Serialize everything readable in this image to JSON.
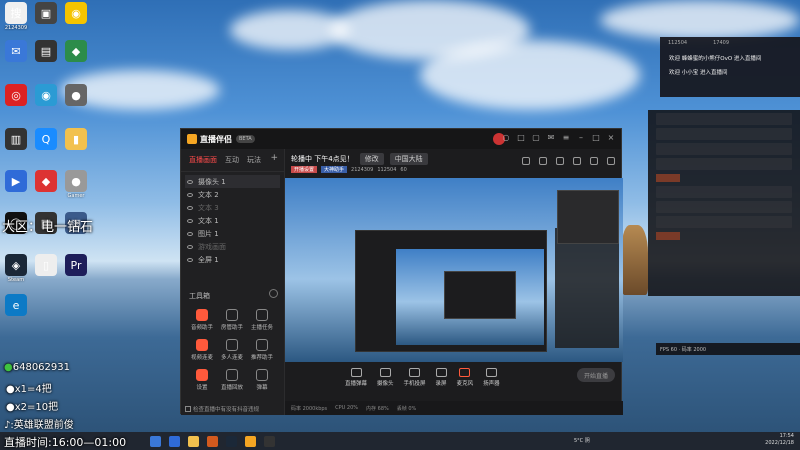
{
  "desktop": {
    "icons": [
      {
        "label": "2124309",
        "color": "#f0f0f0",
        "glyph": "搜"
      },
      {
        "label": "",
        "color": "#444",
        "glyph": "▣"
      },
      {
        "label": "",
        "color": "#f5c400",
        "glyph": "◉"
      },
      {
        "label": "",
        "color": "#3a78d8",
        "glyph": "✉"
      },
      {
        "label": "",
        "color": "#333",
        "glyph": "▤"
      },
      {
        "label": "",
        "color": "#2c8c4a",
        "glyph": "◆"
      },
      {
        "label": "",
        "color": "#d22",
        "glyph": "◎"
      },
      {
        "label": "",
        "color": "#2b9bd4",
        "glyph": "◉"
      },
      {
        "label": "",
        "color": "#666",
        "glyph": "●"
      },
      {
        "label": "",
        "color": "#333",
        "glyph": "▥"
      },
      {
        "label": "",
        "color": "#1a8cff",
        "glyph": "Q"
      },
      {
        "label": "",
        "color": "#f2c14e",
        "glyph": "▮"
      },
      {
        "label": "",
        "color": "#2f6bd8",
        "glyph": "▶"
      },
      {
        "label": "",
        "color": "#d33",
        "glyph": "◆"
      },
      {
        "label": "Gamer",
        "color": "#999",
        "glyph": "●"
      },
      {
        "label": "",
        "color": "#111",
        "glyph": "◯"
      },
      {
        "label": "",
        "color": "#333",
        "glyph": "▦"
      },
      {
        "label": "",
        "color": "#3a5a8a",
        "glyph": "▧"
      },
      {
        "label": "Steam",
        "color": "#1b2838",
        "glyph": "◈"
      },
      {
        "label": "",
        "color": "#eee",
        "glyph": "▯"
      },
      {
        "label": "",
        "color": "#1e1e5a",
        "glyph": "Pr"
      },
      {
        "label": "",
        "color": "#0c7ac6",
        "glyph": "e"
      }
    ]
  },
  "overlay": {
    "region": "大区：电一钻石",
    "wechat": "648062931",
    "x1": "x1=4把",
    "x2": "x2=10把",
    "douyin": "英雄联盟前俊",
    "time": "直播时间:16:00—01:00"
  },
  "app": {
    "name": "直播伴侣",
    "version": "BETA",
    "tabs": [
      "直播画面",
      "互动",
      "玩法"
    ],
    "active_tab": 0,
    "layers": [
      {
        "name": "摄像头 1",
        "selected": true,
        "dim": false
      },
      {
        "name": "文本 2",
        "selected": false,
        "dim": false
      },
      {
        "name": "文本 3",
        "selected": false,
        "dim": true
      },
      {
        "name": "文本 1",
        "selected": false,
        "dim": false
      },
      {
        "name": "图片 1",
        "selected": false,
        "dim": false
      },
      {
        "name": "游戏画面",
        "selected": false,
        "dim": true
      },
      {
        "name": "全屏 1",
        "selected": false,
        "dim": false
      }
    ],
    "tools_heading": "工具箱",
    "tools": [
      {
        "label": "音频助手",
        "hot": true
      },
      {
        "label": "房管助手",
        "hot": false
      },
      {
        "label": "主播任务",
        "hot": false
      },
      {
        "label": "视频连麦",
        "hot": true
      },
      {
        "label": "多人连麦",
        "hot": false
      },
      {
        "label": "推荐助手",
        "hot": false
      },
      {
        "label": "设置",
        "hot": true
      },
      {
        "label": "直播回放",
        "hot": false
      },
      {
        "label": "弹幕",
        "hot": false
      }
    ],
    "footer_check": "检查直播中有没有抖音违规",
    "room_title": "轮播中 下午4点见！",
    "room_btn1": "修改",
    "room_btn2": "中国大陆",
    "stats": {
      "tag1": "开播设置",
      "tag2": "大神助手",
      "viewers": "2124309",
      "likes": "112504",
      "count": "60"
    },
    "toolbar": [
      {
        "label": "直播弹幕",
        "red": false
      },
      {
        "label": "摄像头",
        "red": false
      },
      {
        "label": "手机投屏",
        "red": false
      },
      {
        "label": "录屏",
        "red": false
      },
      {
        "label": "麦克风",
        "red": true
      },
      {
        "label": "扬声器",
        "red": false
      }
    ],
    "golive": "开始直播",
    "status": [
      "码率 2000kbps",
      "CPU 20%",
      "内存 68%",
      "丢帧 0%"
    ]
  },
  "chat": {
    "hdr1": "112504",
    "hdr2": "17409",
    "messages": [
      "欢迎 蜂蜂蜜的小熊仔OvO 进入直播间",
      "欢迎 小小宝 进入直播间"
    ]
  },
  "bottom_overlay_text": "FPS 60 · 码率 2000",
  "taskbar": {
    "weather": "5°C 阴",
    "time": "17:54",
    "date": "2022/12/18"
  }
}
